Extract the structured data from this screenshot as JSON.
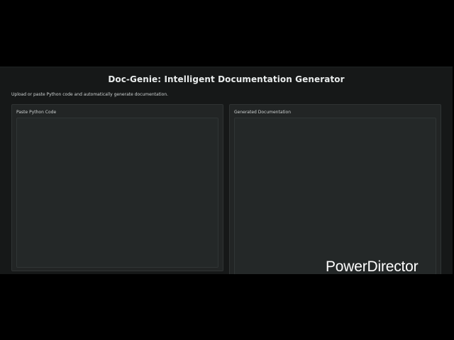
{
  "app": {
    "title": "Doc-Genie: Intelligent Documentation Generator",
    "description": "Upload or paste Python code and automatically generate documentation."
  },
  "input_panel": {
    "label": "Paste Python Code",
    "value": ""
  },
  "output_panel": {
    "label": "Generated Documentation",
    "value": ""
  },
  "watermark": {
    "text": "PowerDirector"
  },
  "colors": {
    "background": "#000000",
    "app_background": "#161818",
    "panel_background": "#222525",
    "text": "#e9ecec"
  }
}
